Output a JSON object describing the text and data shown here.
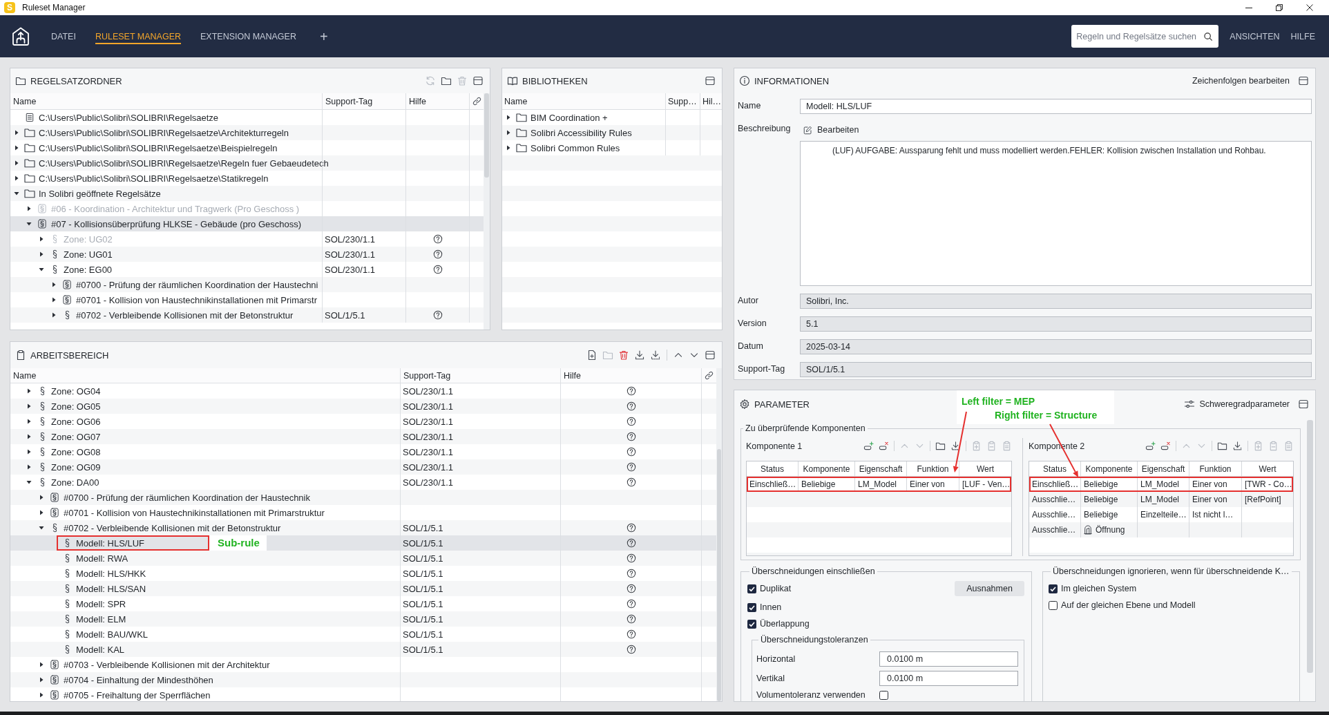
{
  "window": {
    "badge": "S",
    "title": "Ruleset Manager"
  },
  "menu_bar": {
    "tabs": [
      {
        "label": "DATEI",
        "selected": false
      },
      {
        "label": "RULESET MANAGER",
        "selected": true
      },
      {
        "label": "EXTENSION MANAGER",
        "selected": false
      }
    ],
    "add_tab": "+",
    "search": {
      "placeholder": "Regeln und Regelsätze suchen"
    },
    "menus": [
      "ANSICHTEN",
      "HILFE"
    ]
  },
  "regelsatzordner": {
    "title": "REGELSATZORDNER",
    "toolbar": [
      [
        {
          "kind": "refresh",
          "disabled": true
        },
        {
          "kind": "folder",
          "disabled": false
        },
        {
          "kind": "delete",
          "disabled": true
        },
        {
          "kind": "panel",
          "disabled": false
        }
      ]
    ],
    "columns": [
      "Name",
      "Support-Tag",
      "Hilfe"
    ],
    "tree": [
      {
        "name": "C:\\Users\\Public\\Solibri\\SOLIBRI\\Regelsaetze",
        "kind": "file",
        "selected": false,
        "disabled": false,
        "help": false
      },
      {
        "name": "C:\\Users\\Public\\Solibri\\SOLIBRI\\Regelsaetze\\Architekturregeln",
        "kind": "folder",
        "expanded": false,
        "selected": false,
        "disabled": false,
        "help": false
      },
      {
        "name": "C:\\Users\\Public\\Solibri\\SOLIBRI\\Regelsaetze\\Beispielregeln",
        "kind": "folder",
        "expanded": false,
        "selected": false,
        "disabled": false,
        "help": false
      },
      {
        "name": "C:\\Users\\Public\\Solibri\\SOLIBRI\\Regelsaetze\\Regeln fuer Gebaeudetech",
        "kind": "folder",
        "expanded": false,
        "selected": false,
        "disabled": false,
        "help": false
      },
      {
        "name": "C:\\Users\\Public\\Solibri\\SOLIBRI\\Regelsaetze\\Statikregeln",
        "kind": "folder",
        "expanded": false,
        "selected": false,
        "disabled": false,
        "help": false
      },
      {
        "name": "In Solibri geöffnete Regelsätze",
        "kind": "folder",
        "expanded": true,
        "selected": false,
        "disabled": false,
        "help": false,
        "children": [
          {
            "name": "#06 - Koordination - Architektur und Tragwerk (Pro Geschoss )",
            "kind": "ruleset",
            "expanded": false,
            "selected": false,
            "disabled": true,
            "help": false
          },
          {
            "name": "#07 - Kollisionsüberprüfung HLKSE - Gebäude (pro Geschoss)",
            "kind": "ruleset",
            "expanded": true,
            "selected": true,
            "disabled": false,
            "help": false,
            "children": [
              {
                "name": "Zone: UG02",
                "kind": "rule",
                "expanded": false,
                "selected": false,
                "disabled": true,
                "support_tag": "SOL/230/1.1",
                "help": true
              },
              {
                "name": "Zone: UG01",
                "kind": "rule",
                "expanded": false,
                "selected": false,
                "disabled": false,
                "support_tag": "SOL/230/1.1",
                "help": true
              },
              {
                "name": "Zone: EG00",
                "kind": "rule",
                "expanded": true,
                "selected": false,
                "disabled": false,
                "support_tag": "SOL/230/1.1",
                "help": true,
                "children": [
                  {
                    "name": "#0700 - Prüfung der räumlichen Koordination der Haustechni",
                    "kind": "ruleset",
                    "expanded": false,
                    "selected": false,
                    "disabled": false,
                    "help": false
                  },
                  {
                    "name": "#0701 - Kollision von Haustechnikinstallationen mit Primarstr",
                    "kind": "ruleset",
                    "expanded": false,
                    "selected": false,
                    "disabled": false,
                    "help": false
                  },
                  {
                    "name": "#0702 - Verbleibende Kollisionen mit der Betonstruktur",
                    "kind": "rule",
                    "expanded": false,
                    "selected": false,
                    "disabled": false,
                    "support_tag": "SOL/1/5.1",
                    "help": true
                  }
                ]
              }
            ]
          }
        ]
      }
    ]
  },
  "bibliotheken": {
    "title": "BIBLIOTHEKEN",
    "toolbar": [
      [
        {
          "kind": "panel",
          "disabled": false
        }
      ]
    ],
    "columns": [
      "Name",
      "Supp…",
      "Hil…"
    ],
    "tree": [
      {
        "name": "BIM Coordination +",
        "kind": "folder",
        "expanded": false,
        "selected": false,
        "disabled": false,
        "help": false
      },
      {
        "name": "Solibri Accessibility Rules",
        "kind": "folder",
        "expanded": false,
        "selected": false,
        "disabled": false,
        "help": false
      },
      {
        "name": "Solibri Common Rules",
        "kind": "folder",
        "expanded": false,
        "selected": false,
        "disabled": false,
        "help": false
      }
    ]
  },
  "arbeitsbereich": {
    "title": "ARBEITSBEREICH",
    "toolbar": [
      [
        {
          "kind": "new",
          "disabled": false
        },
        {
          "kind": "folder",
          "disabled": true
        },
        {
          "kind": "delete",
          "disabled": false
        },
        {
          "kind": "download",
          "disabled": false
        },
        {
          "kind": "download_all",
          "disabled": false
        }
      ],
      [
        {
          "kind": "up",
          "disabled": false
        },
        {
          "kind": "down",
          "disabled": false
        },
        {
          "kind": "panel",
          "disabled": false
        }
      ]
    ],
    "columns": [
      "Name",
      "Support-Tag",
      "Hilfe"
    ],
    "tree": [
      {
        "name": "Zone: OG04",
        "kind": "rule",
        "expanded": false,
        "selected": false,
        "disabled": false,
        "support_tag": "SOL/230/1.1",
        "help": true
      },
      {
        "name": "Zone: OG05",
        "kind": "rule",
        "expanded": false,
        "selected": false,
        "disabled": false,
        "support_tag": "SOL/230/1.1",
        "help": true
      },
      {
        "name": "Zone: OG06",
        "kind": "rule",
        "expanded": false,
        "selected": false,
        "disabled": false,
        "support_tag": "SOL/230/1.1",
        "help": true
      },
      {
        "name": "Zone: OG07",
        "kind": "rule",
        "expanded": false,
        "selected": false,
        "disabled": false,
        "support_tag": "SOL/230/1.1",
        "help": true
      },
      {
        "name": "Zone: OG08",
        "kind": "rule",
        "expanded": false,
        "selected": false,
        "disabled": false,
        "support_tag": "SOL/230/1.1",
        "help": true
      },
      {
        "name": "Zone: OG09",
        "kind": "rule",
        "expanded": false,
        "selected": false,
        "disabled": false,
        "support_tag": "SOL/230/1.1",
        "help": true
      },
      {
        "name": "Zone: DA00",
        "kind": "rule",
        "expanded": true,
        "selected": false,
        "disabled": false,
        "support_tag": "SOL/230/1.1",
        "help": true,
        "children": [
          {
            "name": "#0700 - Prüfung der räumlichen Koordination der Haustechnik",
            "kind": "ruleset",
            "expanded": false,
            "selected": false,
            "disabled": false,
            "help": false
          },
          {
            "name": "#0701 - Kollision von Haustechnikinstallationen mit Primarstruktur",
            "kind": "ruleset",
            "expanded": false,
            "selected": false,
            "disabled": false,
            "help": false
          },
          {
            "name": "#0702 - Verbleibende Kollisionen mit der Betonstruktur",
            "kind": "rule",
            "expanded": true,
            "selected": false,
            "disabled": false,
            "support_tag": "SOL/1/5.1",
            "help": true,
            "children": [
              {
                "name": "Modell: HLS/LUF",
                "kind": "rule",
                "selected": true,
                "disabled": false,
                "support_tag": "SOL/1/5.1",
                "help": true,
                "annotation": "Sub-rule"
              },
              {
                "name": "Modell: RWA",
                "kind": "rule",
                "selected": false,
                "disabled": false,
                "support_tag": "SOL/1/5.1",
                "help": true
              },
              {
                "name": "Modell: HLS/HKK",
                "kind": "rule",
                "selected": false,
                "disabled": false,
                "support_tag": "SOL/1/5.1",
                "help": true
              },
              {
                "name": "Modell: HLS/SAN",
                "kind": "rule",
                "selected": false,
                "disabled": false,
                "support_tag": "SOL/1/5.1",
                "help": true
              },
              {
                "name": "Modell: SPR",
                "kind": "rule",
                "selected": false,
                "disabled": false,
                "support_tag": "SOL/1/5.1",
                "help": true
              },
              {
                "name": "Modell: ELM",
                "kind": "rule",
                "selected": false,
                "disabled": false,
                "support_tag": "SOL/1/5.1",
                "help": true
              },
              {
                "name": "Modell: BAU/WKL",
                "kind": "rule",
                "selected": false,
                "disabled": false,
                "support_tag": "SOL/1/5.1",
                "help": true
              },
              {
                "name": "Modell: KAL",
                "kind": "rule",
                "selected": false,
                "disabled": false,
                "support_tag": "SOL/1/5.1",
                "help": true
              }
            ]
          },
          {
            "name": "#0703 - Verbleibende Kollisionen mit der Architektur",
            "kind": "ruleset",
            "expanded": false,
            "selected": false,
            "disabled": false,
            "help": false
          },
          {
            "name": "#0704 - Einhaltung der Mindesthöhen",
            "kind": "ruleset",
            "expanded": false,
            "selected": false,
            "disabled": false,
            "help": false
          },
          {
            "name": "#0705 - Freihaltung der Sperrflächen",
            "kind": "ruleset",
            "expanded": false,
            "selected": false,
            "disabled": false,
            "help": false
          }
        ]
      }
    ]
  },
  "informationen": {
    "title": "INFORMATIONEN",
    "action": "Zeichenfolgen bearbeiten",
    "toolbar": [
      [
        {
          "kind": "panel",
          "disabled": false
        }
      ]
    ],
    "fields": [
      {
        "kind": "text",
        "label": "Name",
        "value": "Modell: HLS/LUF",
        "readonly": false
      },
      {
        "kind": "description",
        "label": "Beschreibung",
        "button": "Bearbeiten",
        "value": "(LUF) AUFGABE: Aussparung fehlt und muss modelliert werden.FEHLER: Kollision zwischen Installation und Rohbau.",
        "readonly": false
      },
      {
        "kind": "text",
        "label": "Autor",
        "value": "Solibri, Inc.",
        "readonly": true
      },
      {
        "kind": "text",
        "label": "Version",
        "value": "5.1",
        "readonly": true
      },
      {
        "kind": "text",
        "label": "Datum",
        "value": "2025-03-14",
        "readonly": true
      },
      {
        "kind": "text",
        "label": "Support-Tag",
        "value": "SOL/1/5.1",
        "readonly": true
      }
    ]
  },
  "parameter": {
    "title": "PARAMETER",
    "action": "Schweregradparameter",
    "toolbar": [
      [
        {
          "kind": "panel",
          "disabled": false
        }
      ]
    ],
    "annotations": [
      {
        "text": "Left filter = MEP"
      },
      {
        "text": "Right filter = Structure"
      }
    ],
    "components_group": {
      "legend": "Zu überprüfende Komponenten",
      "components": [
        {
          "label": "Komponente 1",
          "toolbar": [
            [
              {
                "kind": "add_row",
                "disabled": false
              },
              {
                "kind": "remove_row",
                "disabled": false
              }
            ],
            [
              {
                "kind": "up",
                "disabled": true
              },
              {
                "kind": "down",
                "disabled": true
              }
            ],
            [
              {
                "kind": "folder",
                "disabled": false
              },
              {
                "kind": "download_all",
                "disabled": false
              }
            ],
            [
              {
                "kind": "clip_add",
                "disabled": true
              },
              {
                "kind": "clip_remove",
                "disabled": true
              },
              {
                "kind": "clip_list",
                "disabled": true
              }
            ]
          ],
          "columns": [
            "Status",
            "Komponente",
            "Eigenschaft",
            "Funktion",
            "Wert"
          ],
          "rows": [
            {
              "cells": [
                "Einschließ…",
                "Beliebige",
                "LM_Model",
                "Einer von",
                "[LUF - Ven…"
              ],
              "component_icon": false,
              "highlighted": true
            }
          ]
        },
        {
          "label": "Komponente 2",
          "toolbar": [
            [
              {
                "kind": "add_row",
                "disabled": false
              },
              {
                "kind": "remove_row",
                "disabled": false
              }
            ],
            [
              {
                "kind": "up",
                "disabled": true
              },
              {
                "kind": "down",
                "disabled": true
              }
            ],
            [
              {
                "kind": "folder",
                "disabled": false
              },
              {
                "kind": "download_all",
                "disabled": false
              }
            ],
            [
              {
                "kind": "clip_add",
                "disabled": true
              },
              {
                "kind": "clip_remove",
                "disabled": true
              },
              {
                "kind": "clip_list",
                "disabled": true
              }
            ]
          ],
          "columns": [
            "Status",
            "Komponente",
            "Eigenschaft",
            "Funktion",
            "Wert"
          ],
          "rows": [
            {
              "cells": [
                "Einschließ…",
                "Beliebige",
                "LM_Model",
                "Einer von",
                "[TWR - Co…"
              ],
              "component_icon": false,
              "highlighted": true
            },
            {
              "cells": [
                "Ausschlie…",
                "Beliebige",
                "LM_Model",
                "Einer von",
                "[RefPoint]"
              ],
              "component_icon": false,
              "highlighted": false
            },
            {
              "cells": [
                "Ausschlie…",
                "Beliebige",
                "Einzelteile…",
                "Ist nicht l…"
              ],
              "component_icon": false,
              "highlighted": false
            },
            {
              "cells": [
                "Ausschlie…",
                "Öffnung"
              ],
              "component_icon": true,
              "highlighted": false
            }
          ]
        }
      ]
    },
    "include_group": {
      "legend": "Überschneidungen einschließen",
      "checks": [
        {
          "label": "Duplikat",
          "checked": true
        },
        {
          "label": "Innen",
          "checked": true
        },
        {
          "label": "Überlappung",
          "checked": true
        }
      ],
      "button": "Ausnahmen",
      "tolerances": {
        "legend": "Überschneidungstoleranzen",
        "fields": [
          {
            "label": "Horizontal",
            "value": "0.0100 m"
          },
          {
            "label": "Vertikal",
            "value": "0.0100 m"
          }
        ],
        "volume": {
          "label": "Volumentoleranz verwenden",
          "checked": false
        }
      }
    },
    "ignore_group": {
      "legend": "Überschneidungen ignorieren, wenn für überschneidende K…",
      "checks": [
        {
          "label": "Im gleichen System",
          "checked": true
        },
        {
          "label": "Auf der gleichen Ebene und Modell",
          "checked": false
        }
      ]
    }
  }
}
